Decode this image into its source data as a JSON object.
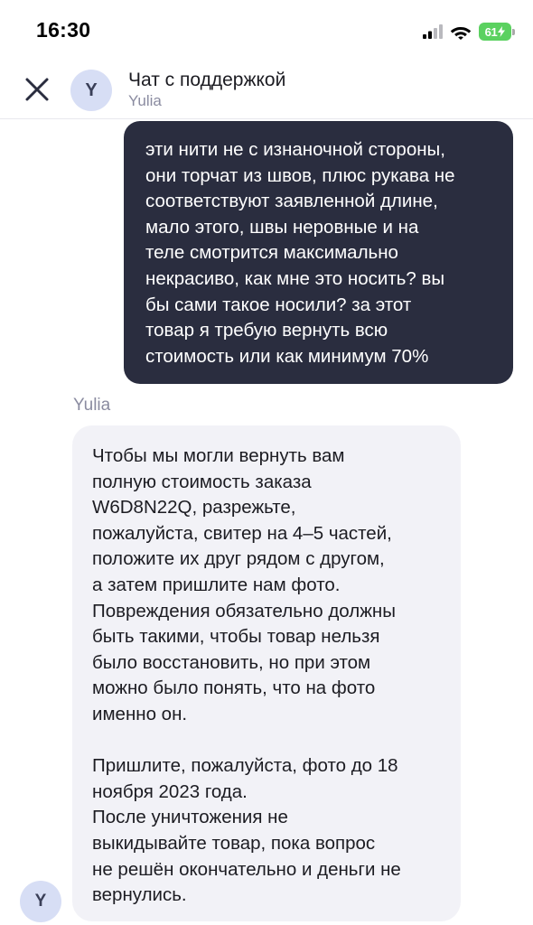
{
  "status_bar": {
    "time": "16:30",
    "battery": "61",
    "icons": [
      "cellular-signal-icon",
      "wifi-icon",
      "battery-charging-icon"
    ]
  },
  "header": {
    "title": "Чат с поддержкой",
    "subtitle": "Yulia",
    "avatar_letter": "Y",
    "close_icon": "close-icon"
  },
  "messages": [
    {
      "direction": "outgoing",
      "text": "эти нити не с изнаночной стороны,\nони торчат из швов, плюс рукава не\nсоответствуют заявленной длине,\nмало этого, швы неровные и на\nтеле смотрится максимально\nнекрасиво, как мне это носить? вы\nбы сами такое носили? за этот\nтовар я требую вернуть всю\nстоимость или как минимум 70%"
    },
    {
      "direction": "incoming",
      "sender": "Yulia",
      "avatar_letter": "Y",
      "text": "Чтобы мы могли вернуть вам\nполную стоимость заказа\nW6D8N22Q, разрежьте,\nпожалуйста, свитер на 4–5 частей,\nположите их друг рядом с другом,\nа затем пришлите нам фото.\nПовреждения обязательно должны\nбыть такими, чтобы товар нельзя\nбыло восстановить, но при этом\nможно было понять, что на фото\nименно он.\n\nПришлите, пожалуйста, фото до 18\nноября 2023 года.\nПосле уничтожения не\nвыкидывайте товар, пока вопрос\nне решён окончательно и деньги не\nвернулись."
    }
  ],
  "colors": {
    "outgoing_bubble": "#2a2d3f",
    "incoming_bubble": "#f2f2f7",
    "avatar_bg": "#d7def5",
    "secondary_text": "#8a8ba0",
    "battery_green": "#5bd160"
  }
}
